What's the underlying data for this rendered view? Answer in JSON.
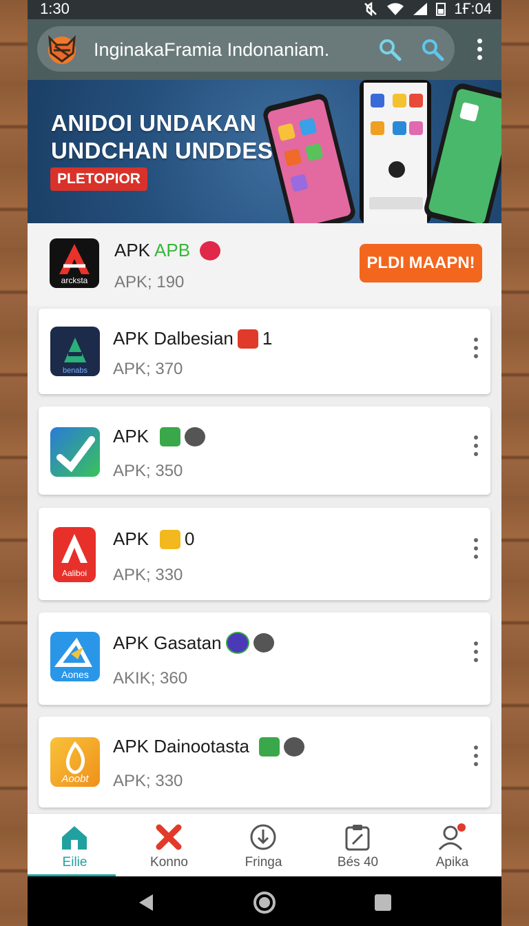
{
  "status_bar": {
    "time": "1:30",
    "right_time": "1Ғ:04"
  },
  "search": {
    "query": "InginakaFramia Indonaniam."
  },
  "banner": {
    "line1": "ANIDOI UNDAKAN",
    "line2": "UNDCHAN UNDDESIA",
    "badge": "PLETOPIOR"
  },
  "featured": {
    "name": "APK",
    "tag": "APB",
    "meta": "APK; 190",
    "icon_text": "arcksta",
    "button": "PLDI MAAPN!"
  },
  "apps": [
    {
      "name": "APK Dalbesian",
      "suffix": "1",
      "meta": "APK; 370",
      "icon_text": "benabs"
    },
    {
      "name": "APK",
      "suffix": "",
      "meta": "APK; 350",
      "icon_text": ""
    },
    {
      "name": "APK",
      "suffix": "0",
      "meta": "APK; 330",
      "icon_text": "Aaliboi"
    },
    {
      "name": "APK Gasatan",
      "suffix": "",
      "meta": "AKIK; 360",
      "icon_text": "Aones"
    },
    {
      "name": "APK Dainootasta",
      "suffix": "",
      "meta": "APK; 330",
      "icon_text": "Aoobt"
    }
  ],
  "bottom_nav": [
    {
      "label": "Eilie",
      "icon": "home-icon",
      "active": true
    },
    {
      "label": "Konno",
      "icon": "x-mark-icon",
      "active": false
    },
    {
      "label": "Fringa",
      "icon": "download-icon",
      "active": false
    },
    {
      "label": "Bés 40",
      "icon": "clipboard-icon",
      "active": false
    },
    {
      "label": "Apika",
      "icon": "profile-icon",
      "active": false
    }
  ],
  "colors": {
    "accent": "#21a0a0",
    "cta": "#f2661e",
    "toolbar": "#4c5d5e",
    "banner": "#25507d"
  }
}
